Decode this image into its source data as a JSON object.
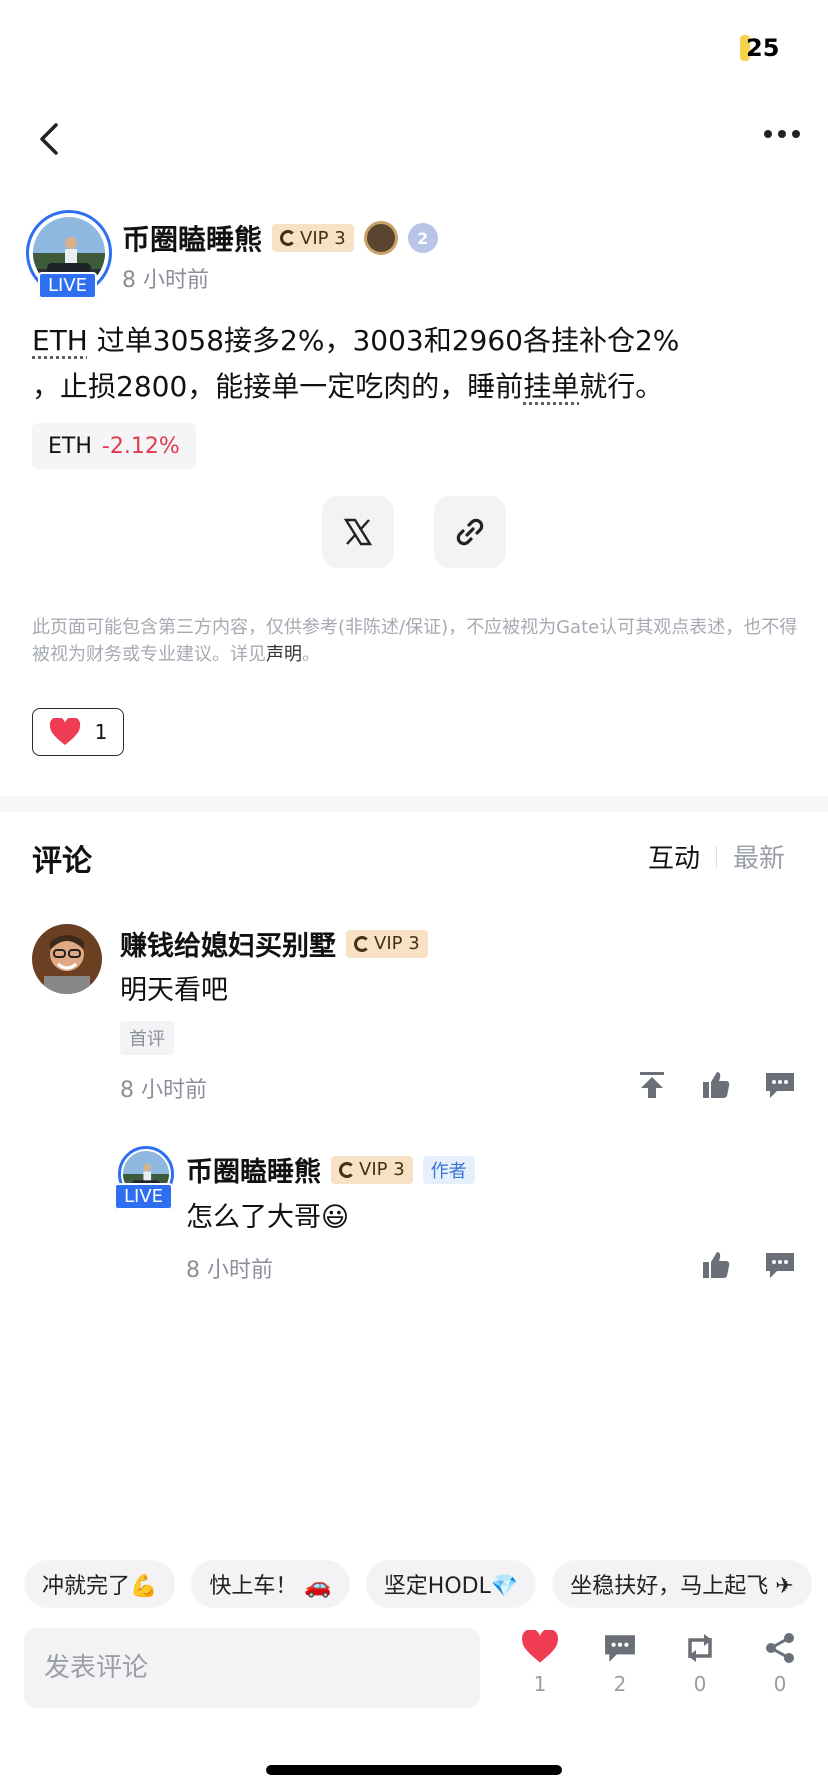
{
  "status": {
    "battery": "25"
  },
  "post": {
    "author": "币圈瞌睡熊",
    "live": "LIVE",
    "vip": "VIP 3",
    "level_badge": "2",
    "time": "8 小时前",
    "text_parts": [
      "ETH",
      " 过单3058接多2%，3003和2960各挂补仓2%",
      "，止损2800，能接单一定吃肉的，睡前",
      "挂单",
      "就行。"
    ],
    "coin": {
      "symbol": "ETH",
      "change": "-2.12%"
    },
    "disclaimer_text": "此页面可能包含第三方内容，仅供参考(非陈述/保证)，不应被视为Gate认可其观点表述，也不得被视为财务或专业建议。详见",
    "disclaimer_link": "声明",
    "disclaimer_end": "。",
    "likes": "1"
  },
  "comments": {
    "title": "评论",
    "sort_active": "互动",
    "sort_inactive": "最新",
    "items": [
      {
        "author": "赚钱给媳妇买别墅",
        "vip": "VIP 3",
        "text": "明天看吧",
        "tag": "首评",
        "time": "8 小时前"
      },
      {
        "author": "币圈瞌睡熊",
        "live": "LIVE",
        "vip": "VIP 3",
        "author_tag": "作者",
        "text": "怎么了大哥😃",
        "time": "8 小时前"
      }
    ]
  },
  "quick_replies": [
    "冲就完了💪",
    "快上车！ 🚗",
    "坚定HODL💎",
    "坐稳扶好，马上起飞 ✈"
  ],
  "bottom_bar": {
    "placeholder": "发表评论",
    "likes": "1",
    "comments": "2",
    "reposts": "0",
    "shares": "0"
  },
  "colors": {
    "live_blue": "#2d6ff0",
    "vip_bg": "#f7e2c5",
    "negative_red": "#e0394d",
    "heart_red": "#ef3c52"
  }
}
